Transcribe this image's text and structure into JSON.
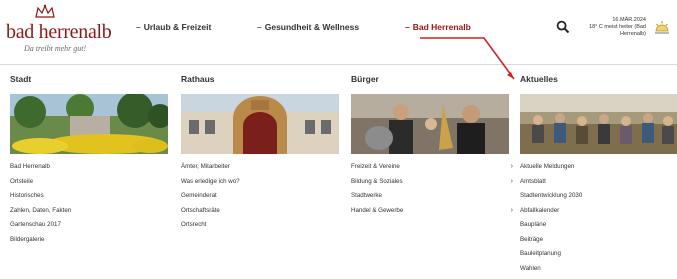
{
  "logo": {
    "name": "bad herrenalb",
    "slogan": "Da treibt mehr gut!"
  },
  "nav": [
    {
      "label": "Urlaub & Freizeit"
    },
    {
      "label": "Gesundheit & Wellness"
    },
    {
      "label": "Bad Herrenalb"
    }
  ],
  "date": {
    "line1": "16.MÄR.2024",
    "line2": "18° C meist heiter (Bad Herrenalb)"
  },
  "columns": [
    {
      "title": "Stadt",
      "links": [
        {
          "label": "Bad Herrenalb"
        },
        {
          "label": "Ortsteile"
        },
        {
          "label": "Historisches"
        },
        {
          "label": "Zahlen, Daten, Fakten"
        },
        {
          "label": "Gartenschau 2017"
        },
        {
          "label": "Bildergalerie"
        }
      ]
    },
    {
      "title": "Rathaus",
      "links": [
        {
          "label": "Ämter, Mitarbeiter"
        },
        {
          "label": "Was erledige ich wo?"
        },
        {
          "label": "Gemeinderat"
        },
        {
          "label": "Ortschaftsräte"
        },
        {
          "label": "Ortsrecht"
        }
      ]
    },
    {
      "title": "Bürger",
      "links": [
        {
          "label": "Freizeit & Vereine",
          "arrow": "›"
        },
        {
          "label": "Bildung & Soziales",
          "arrow": "›"
        },
        {
          "label": "Stadtwerke"
        },
        {
          "label": "Handel & Gewerbe",
          "arrow": "›"
        }
      ]
    },
    {
      "title": "Aktuelles",
      "links": [
        {
          "label": "Aktuelle Meldungen",
          "arrow": "›"
        },
        {
          "label": "Amtsblatt"
        },
        {
          "label": "Stadtentwicklung 2030"
        },
        {
          "label": "Abfallkalender"
        },
        {
          "label": "Baupläne"
        },
        {
          "label": "Beiträge"
        },
        {
          "label": "Bauleitplanung"
        },
        {
          "label": "Wahlen"
        }
      ]
    }
  ],
  "colors": {
    "brand": "#8b1a1a",
    "annotation": "#d42020",
    "accent_gold": "#c9a42b"
  },
  "icons": {
    "search": "search-icon",
    "weather": "sun-icon",
    "crown": "crown-icon"
  }
}
